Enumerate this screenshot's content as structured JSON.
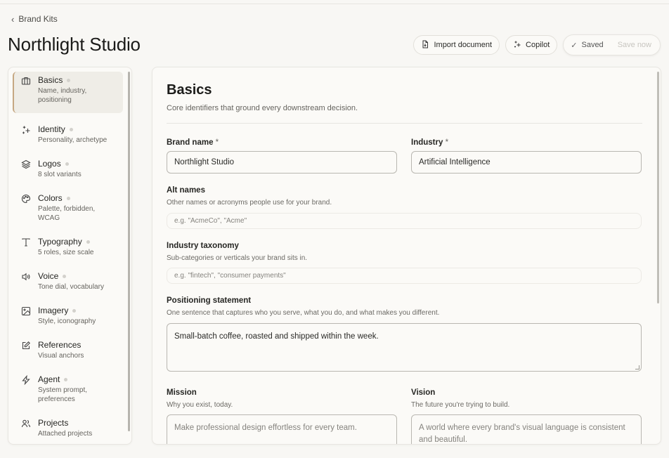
{
  "back_label": "Brand Kits",
  "page_title": "Northlight Studio",
  "actions": {
    "import_label": "Import document",
    "copilot_label": "Copilot",
    "saved_label": "Saved",
    "save_now_label": "Save now"
  },
  "sidebar": {
    "items": [
      {
        "label": "Basics",
        "sub": "Name, industry, positioning",
        "icon": "briefcase-icon",
        "active": true
      },
      {
        "label": "Identity",
        "sub": "Personality, archetype",
        "icon": "sparkles-icon"
      },
      {
        "label": "Logos",
        "sub": "8 slot variants",
        "icon": "layers-icon"
      },
      {
        "label": "Colors",
        "sub": "Palette, forbidden, WCAG",
        "icon": "palette-icon"
      },
      {
        "label": "Typography",
        "sub": "5 roles, size scale",
        "icon": "type-icon"
      },
      {
        "label": "Voice",
        "sub": "Tone dial, vocabulary",
        "icon": "speaker-icon"
      },
      {
        "label": "Imagery",
        "sub": "Style, iconography",
        "icon": "image-icon"
      },
      {
        "label": "References",
        "sub": "Visual anchors",
        "icon": "edit-icon"
      },
      {
        "label": "Agent",
        "sub": "System prompt, preferences",
        "icon": "bolt-icon"
      },
      {
        "label": "Projects",
        "sub": "Attached projects",
        "icon": "users-icon"
      }
    ]
  },
  "section": {
    "title": "Basics",
    "description": "Core identifiers that ground every downstream decision."
  },
  "fields": {
    "brand_name": {
      "label": "Brand name",
      "required": "*",
      "value": "Northlight Studio"
    },
    "industry": {
      "label": "Industry",
      "required": "*",
      "value": "Artificial Intelligence"
    },
    "alt_names": {
      "label": "Alt names",
      "help": "Other names or acronyms people use for your brand.",
      "placeholder": "e.g. \"AcmeCo\", \"Acme\""
    },
    "taxonomy": {
      "label": "Industry taxonomy",
      "help": "Sub-categories or verticals your brand sits in.",
      "placeholder": "e.g. \"fintech\", \"consumer payments\""
    },
    "positioning": {
      "label": "Positioning statement",
      "help": "One sentence that captures who you serve, what you do, and what makes you different.",
      "value": "Small-batch coffee, roasted and shipped within the week."
    },
    "mission": {
      "label": "Mission",
      "help": "Why you exist, today.",
      "placeholder": "Make professional design effortless for every team."
    },
    "vision": {
      "label": "Vision",
      "help": "The future you're trying to build.",
      "placeholder": "A world where every brand's visual language is consistent and beautiful."
    }
  }
}
